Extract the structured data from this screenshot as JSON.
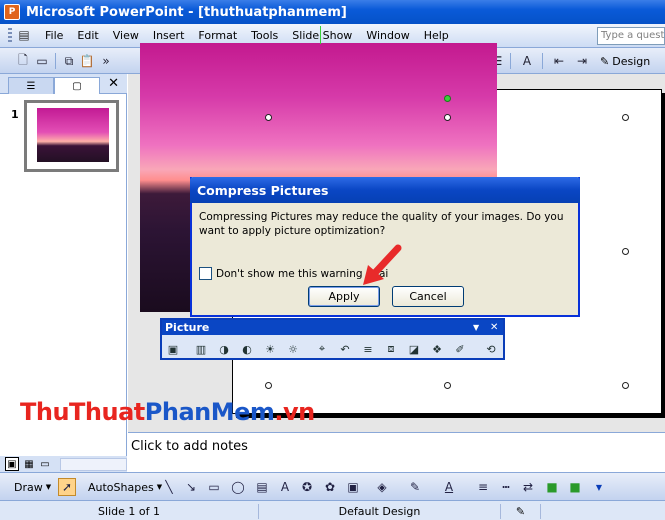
{
  "window": {
    "title": "Microsoft PowerPoint - [thuthuatphanmem]",
    "app_icon": "powerpoint-icon"
  },
  "menubar": {
    "items": [
      "File",
      "Edit",
      "View",
      "Insert",
      "Format",
      "Tools",
      "Slide Show",
      "Window",
      "Help"
    ],
    "search_placeholder": "Type a questi"
  },
  "toolbar": {
    "design_label": "Design"
  },
  "left_pane": {
    "slide_number": "1"
  },
  "notes": {
    "placeholder": "Click to add notes"
  },
  "dialog": {
    "title": "Compress Pictures",
    "message": "Compressing Pictures may reduce the quality of your images. Do you want to apply picture optimization?",
    "checkbox_label": "Don't show me this warning agai",
    "checkbox_checked": false,
    "apply_label": "Apply",
    "cancel_label": "Cancel"
  },
  "picture_toolbar": {
    "title": "Picture"
  },
  "drawbar": {
    "draw_label": "Draw",
    "autoshapes_label": "AutoShapes"
  },
  "statusbar": {
    "slide_info": "Slide 1 of 1",
    "design_name": "Default Design"
  },
  "watermark": {
    "part1": "ThuThuat",
    "part2": "PhanMem",
    "part3": ".vn"
  },
  "colors": {
    "title_blue": "#0a46c4",
    "watermark_red": "#e8251f",
    "watermark_blue": "#1a57c8",
    "annotation_red": "#e82a2a"
  }
}
